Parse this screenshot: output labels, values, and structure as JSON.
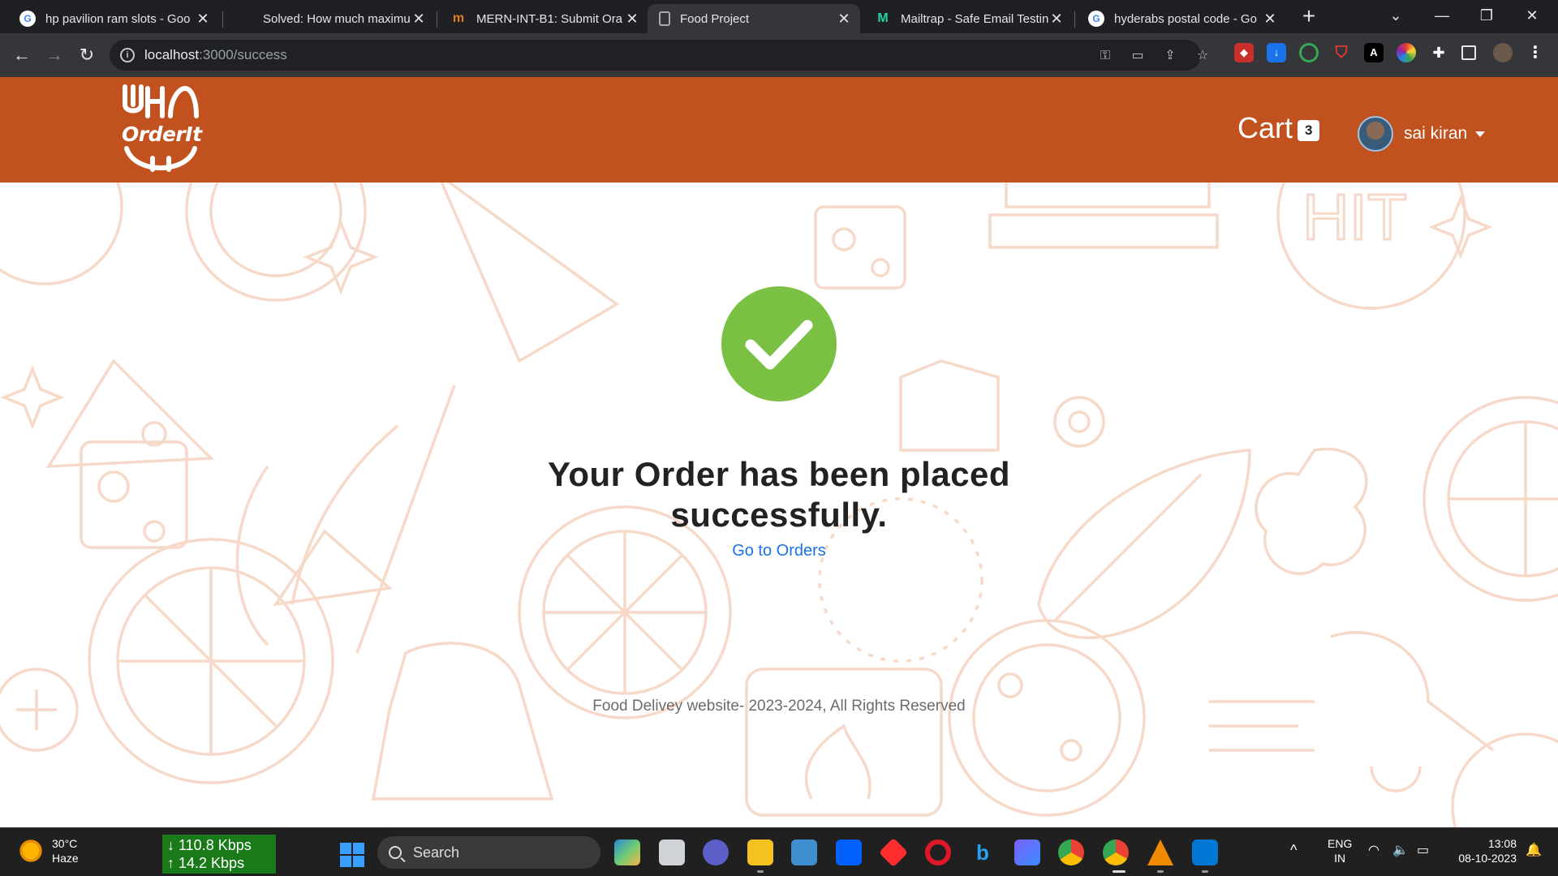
{
  "browser": {
    "tabs": [
      {
        "title": "hp pavilion ram slots - Goo",
        "favicon": "google-icon"
      },
      {
        "title": "Solved: How much maximu",
        "favicon": "hp-icon"
      },
      {
        "title": "MERN-INT-B1: Submit Ora",
        "favicon": "masai-icon"
      },
      {
        "title": "Food Project",
        "favicon": "file-icon"
      },
      {
        "title": "Mailtrap - Safe Email Testin",
        "favicon": "mailtrap-icon"
      },
      {
        "title": "hyderabs postal code - Go",
        "favicon": "google-icon"
      }
    ],
    "url_host": "localhost",
    "url_path": ":3000/success"
  },
  "navbar": {
    "brand": "OrderIt",
    "cart_label": "Cart",
    "cart_count": "3",
    "user_name": "sai kiran"
  },
  "main": {
    "title": "Your Order has been placed successfully.",
    "link": "Go to Orders"
  },
  "footer": {
    "text": "Food Delivey website- 2023-2024, All Rights Reserved"
  },
  "taskbar": {
    "temperature": "30°C",
    "condition": "Haze",
    "download": "↓ 110.8 Kbps",
    "upload": "↑ 14.2 Kbps",
    "search_label": "Search",
    "language": "ENG",
    "region": "IN",
    "time": "13:08",
    "date": "08-10-2023"
  },
  "colors": {
    "brand": "#c1521f",
    "success": "#7ac143",
    "link": "#1a73e8"
  }
}
